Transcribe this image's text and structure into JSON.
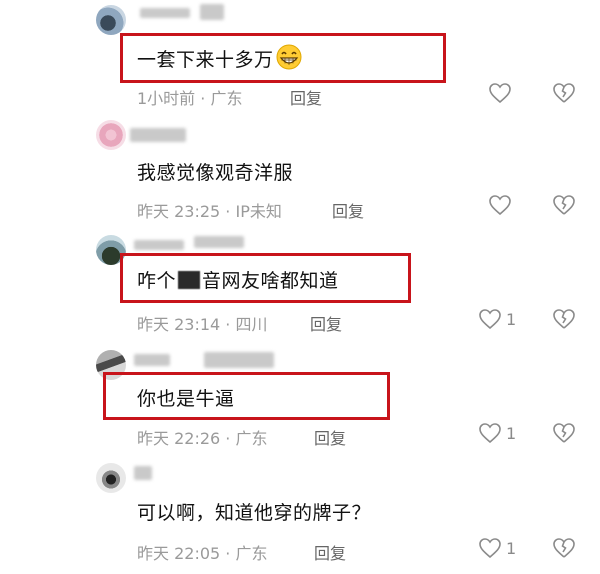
{
  "comments": [
    {
      "text": "一套下来十多万",
      "time": "1小时前",
      "location": "广东",
      "reply_label": "回复",
      "likes": "",
      "emoji": "grinning-face-icon"
    },
    {
      "text": "我感觉像观奇洋服",
      "time": "昨天 23:25",
      "location": "IP未知",
      "reply_label": "回复",
      "likes": ""
    },
    {
      "text_before": "咋个",
      "text_after": "音网友啥都知道",
      "time": "昨天 23:14",
      "location": "四川",
      "reply_label": "回复",
      "likes": "1"
    },
    {
      "text": "你也是牛逼",
      "time": "昨天 22:26",
      "location": "广东",
      "reply_label": "回复",
      "likes": "1"
    },
    {
      "text": "可以啊，知道他穿的牌子？",
      "time": "昨天 22:05",
      "location": "广东",
      "reply_label": "回复",
      "likes": "1"
    }
  ],
  "colors": {
    "highlight_box": "#c8141b",
    "meta_text": "#9a9a9a"
  }
}
